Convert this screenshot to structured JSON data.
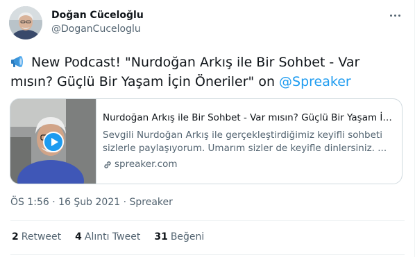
{
  "author": {
    "name": "Doğan Cüceloğlu",
    "handle": "@DoganCuceloglu"
  },
  "tweet": {
    "emoji_icon": "megaphone-icon",
    "text": "New Podcast! \"Nurdoğan Arkış ile Bir Sohbet - Var mısın? Güçlü Bir Yaşam İçin Öneriler\" on ",
    "mention": "@Spreaker"
  },
  "card": {
    "title": "Nurdoğan Arkış ile Bir Sohbet - Var mısın? Güçlü Bir Yaşam İçi...",
    "description": "Sevgili Nurdoğan Arkış ile gerçekleştirdiğimiz keyifli sohbeti sizlerle paylaşıyorum. Umarım sizler de keyifle dinlersiniz. ...",
    "domain": "spreaker.com",
    "thumb_icon": "play-icon"
  },
  "meta": {
    "time": "ÖS 1:56",
    "separator": "·",
    "date": "16 Şub 2021",
    "source": "Spreaker"
  },
  "stats": [
    {
      "count": "2",
      "label": "Retweet"
    },
    {
      "count": "4",
      "label": "Alıntı Tweet"
    },
    {
      "count": "31",
      "label": "Beğeni"
    }
  ],
  "colors": {
    "accent": "#1d9bf0",
    "text": "#0f1419",
    "secondary": "#536471",
    "border": "#cfd9de"
  }
}
